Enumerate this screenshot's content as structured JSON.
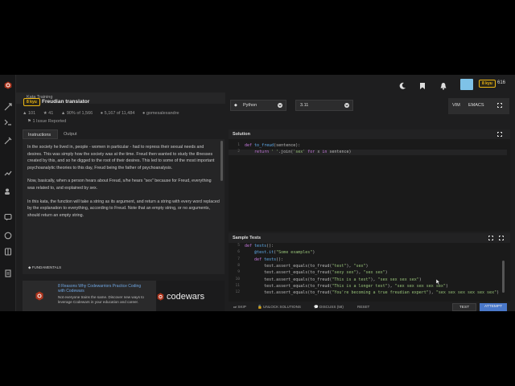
{
  "topbar": {
    "rank": "8 kyu",
    "honor": "616"
  },
  "subheader": {
    "label": "Kata Training"
  },
  "kata": {
    "rank": "8 kyu",
    "title": "Freudian translator",
    "votes": "101",
    "stars": "41",
    "satisfaction": "90% of 1,566",
    "completed": "5,167 of 11,484",
    "author": "gomesalexandre",
    "issues": "1 Issue Reported"
  },
  "tabs": [
    {
      "label": "Instructions"
    },
    {
      "label": "Output"
    }
  ],
  "description": {
    "p1": "In the society he lived in, people - women in particular - had to repress their sexual needs and desires. This was simply how the society was at the time. Freud then wanted to study the illnesses created by this, and so he digged to the root of their desires. This led to some of the most important psychoanalytic theories to this day, Freud being the father of psychoanalysis.",
    "p2": "Now, basically, when a person hears about Freud, s/he hears \"sex\" because for Freud, everything was related to, and explained by sex.",
    "p3": "In this kata, the function will take a string as its argument, and return a string with every word replaced by the explanation to everything, according to Freud. Note that an empty string, or no arguments, should return an empty string."
  },
  "tag": "FUNDAMENTALS",
  "ad": {
    "title": "8 Reasons Why Codewarriors Practice Coding with Codewars",
    "text": "Not everyone trains the same. Discover new ways to leverage Codewars in your education and career.",
    "logo": "codewars"
  },
  "language": "Python",
  "version": "3.11",
  "editor_modes": {
    "vim": "VIM",
    "emacs": "EMACS"
  },
  "solution": {
    "title": "Solution",
    "lines": [
      {
        "n": "1",
        "parts": [
          [
            "kw",
            "def "
          ],
          [
            "fn",
            "to_freud"
          ],
          [
            "tx",
            "(sentence):"
          ]
        ]
      },
      {
        "n": "2",
        "parts": [
          [
            "tx",
            "    "
          ],
          [
            "kw",
            "return "
          ],
          [
            "str",
            "' '"
          ],
          [
            "tx",
            ".join("
          ],
          [
            "str",
            "'sex'"
          ],
          [
            "kw",
            " for "
          ],
          [
            "tx",
            "x "
          ],
          [
            "kw",
            "in "
          ],
          [
            "tx",
            "sentence)"
          ]
        ]
      }
    ]
  },
  "sample_tests": {
    "title": "Sample Tests",
    "lines": [
      {
        "n": "5",
        "parts": [
          [
            "kw",
            "def "
          ],
          [
            "fn",
            "tests"
          ],
          [
            "tx",
            "():"
          ]
        ]
      },
      {
        "n": "6",
        "parts": [
          [
            "tx",
            "    "
          ],
          [
            "fn",
            "@test.it"
          ],
          [
            "tx",
            "("
          ],
          [
            "str",
            "\"Some examples\""
          ],
          [
            "tx",
            ")"
          ]
        ]
      },
      {
        "n": "7",
        "parts": [
          [
            "tx",
            "    "
          ],
          [
            "kw",
            "def "
          ],
          [
            "fn",
            "tests"
          ],
          [
            "tx",
            "():"
          ]
        ]
      },
      {
        "n": "8",
        "parts": [
          [
            "tx",
            "        test.assert_equals(to_freud("
          ],
          [
            "str",
            "\"test\""
          ],
          [
            "tx",
            "), "
          ],
          [
            "str",
            "\"sex\""
          ],
          [
            "tx",
            ")"
          ]
        ]
      },
      {
        "n": "9",
        "parts": [
          [
            "tx",
            "        test.assert_equals(to_freud("
          ],
          [
            "str",
            "\"sexy sex\""
          ],
          [
            "tx",
            "), "
          ],
          [
            "str",
            "\"sex sex\""
          ],
          [
            "tx",
            ")"
          ]
        ]
      },
      {
        "n": "10",
        "parts": [
          [
            "tx",
            "        test.assert_equals(to_freud("
          ],
          [
            "str",
            "\"This is a test\""
          ],
          [
            "tx",
            "), "
          ],
          [
            "str",
            "\"sex sex sex sex\""
          ],
          [
            "tx",
            ")"
          ]
        ]
      },
      {
        "n": "11",
        "parts": [
          [
            "tx",
            "        test.assert_equals(to_freud("
          ],
          [
            "str",
            "\"This is a longer test\""
          ],
          [
            "tx",
            "), "
          ],
          [
            "str",
            "\"sex sex sex sex sex\""
          ],
          [
            "tx",
            ")"
          ]
        ]
      },
      {
        "n": "12",
        "parts": [
          [
            "tx",
            "        test.assert_equals(to_freud("
          ],
          [
            "str",
            "\"You're becoming a true freudian expert\""
          ],
          [
            "tx",
            "), "
          ],
          [
            "str",
            "\"sex sex sex sex sex sex\""
          ],
          [
            "tx",
            ")"
          ]
        ]
      }
    ]
  },
  "bottombar": {
    "skip": "SKIP",
    "unlock": "UNLOCK SOLUTIONS",
    "discuss": "DISCUSS (58)",
    "reset": "RESET",
    "test": "TEST",
    "attempt": "ATTEMPT"
  },
  "colors": {
    "accent": "#b1361e",
    "attempt": "#4a78c9",
    "rank": "#ecb613"
  }
}
